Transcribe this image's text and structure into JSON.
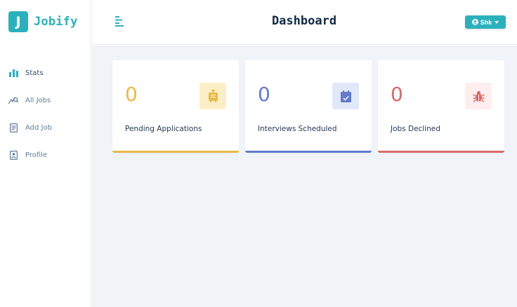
{
  "brand": {
    "letter": "J",
    "name": "Jobify"
  },
  "sidebar": {
    "items": [
      {
        "label": "Stats",
        "icon": "bar-chart-icon"
      },
      {
        "label": "All Jobs",
        "icon": "job-search-icon"
      },
      {
        "label": "Add Job",
        "icon": "form-icon"
      },
      {
        "label": "Profile",
        "icon": "id-card-icon"
      }
    ],
    "active_index": 0
  },
  "header": {
    "title": "Dashboard",
    "toggle_icon": "menu-toggle-icon",
    "user": {
      "label": "Shk",
      "icon": "user-circle-icon",
      "caret": "caret-down-icon"
    }
  },
  "stats": [
    {
      "count": "0",
      "label": "Pending Applications",
      "icon": "suitcase-icon",
      "color": "#e9b949",
      "bg": "#fcefc7"
    },
    {
      "count": "0",
      "label": "Interviews Scheduled",
      "icon": "calendar-check-icon",
      "color": "#647acb",
      "bg": "#e0e8f9"
    },
    {
      "count": "0",
      "label": "Jobs Declined",
      "icon": "bug-icon",
      "color": "#d66a6a",
      "bg": "#ffeeee"
    }
  ],
  "colors": {
    "primary": "#2cb1bc",
    "background": "#f0f4f8"
  }
}
